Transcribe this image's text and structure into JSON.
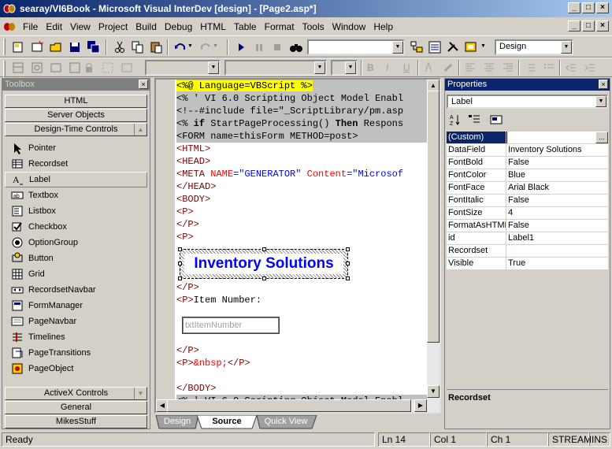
{
  "window": {
    "title": "searay/VI6Book - Microsoft Visual InterDev [design] - [Page2.asp*]",
    "caption_buttons": [
      "_",
      "□",
      "×"
    ]
  },
  "menu": [
    "File",
    "Edit",
    "View",
    "Project",
    "Build",
    "Debug",
    "HTML",
    "Table",
    "Format",
    "Tools",
    "Window",
    "Help"
  ],
  "toolbar": {
    "mode_combo": "Design",
    "paragraph_combo": "",
    "font_combo": ""
  },
  "toolbox": {
    "title": "Toolbox",
    "tabs_top": [
      "HTML",
      "Server Objects",
      "Design-Time Controls"
    ],
    "items": [
      {
        "label": "Pointer",
        "icon": "pointer-icon"
      },
      {
        "label": "Recordset",
        "icon": "recordset-icon"
      },
      {
        "label": "Label",
        "icon": "label-icon"
      },
      {
        "label": "Textbox",
        "icon": "textbox-icon"
      },
      {
        "label": "Listbox",
        "icon": "listbox-icon"
      },
      {
        "label": "Checkbox",
        "icon": "checkbox-icon"
      },
      {
        "label": "OptionGroup",
        "icon": "optiongroup-icon"
      },
      {
        "label": "Button",
        "icon": "button-icon"
      },
      {
        "label": "Grid",
        "icon": "grid-icon"
      },
      {
        "label": "RecordsetNavbar",
        "icon": "recordsetnavbar-icon"
      },
      {
        "label": "FormManager",
        "icon": "formmanager-icon"
      },
      {
        "label": "PageNavbar",
        "icon": "pagenavbar-icon"
      },
      {
        "label": "Timelines",
        "icon": "timelines-icon"
      },
      {
        "label": "PageTransitions",
        "icon": "pagetransitions-icon"
      },
      {
        "label": "PageObject",
        "icon": "pageobject-icon"
      }
    ],
    "tabs_bottom": [
      "ActiveX Controls",
      "General",
      "MikesStuff"
    ]
  },
  "editor": {
    "lines": {
      "l1": "<%@ Language=VBScript %>",
      "l2a": "<% ' VI 6.0 Scripting Object Model Enabl",
      "l3": "<!--#include file=\"_ScriptLibrary/pm.asp",
      "l4a": "<% ",
      "l4b": "if",
      "l4c": " StartPageProcessing() ",
      "l4d": "Then",
      "l4e": " Respons",
      "l5": "<FORM name=thisForm METHOD=post>",
      "l6": "<HTML>",
      "l7": "<HEAD>",
      "l8a": "<META ",
      "l8b": "NAME",
      "l8c": "=",
      "l8d": "\"GENERATOR\"",
      "l8e": " Content",
      "l8f": "=",
      "l8g": "\"Microsof",
      "l9": "</HEAD>",
      "l10": "<BODY>",
      "l11": "<P>",
      "l12": "</P>",
      "l13": "<P>",
      "l14": "</P>",
      "l15a": "<P>",
      "l15b": "Item Number:",
      "l16": "</P>",
      "l17a": "<P>",
      "l17b": "&nbsp;",
      "l17c": "</P>",
      "l18": "</BODY>",
      "l19": "<% ' VI 6.0 Scripting Object Model Enabl"
    },
    "label_control_text": "Inventory Solutions",
    "textbox_placeholder": "txtItemNumber",
    "tabs": [
      "Design",
      "Source",
      "Quick View"
    ]
  },
  "properties": {
    "title": "Properties",
    "object_combo": "Label",
    "rows": [
      {
        "name": "(Custom)",
        "value": ""
      },
      {
        "name": "DataField",
        "value": "Inventory Solutions"
      },
      {
        "name": "FontBold",
        "value": "False"
      },
      {
        "name": "FontColor",
        "value": "Blue"
      },
      {
        "name": "FontFace",
        "value": "Arial Black"
      },
      {
        "name": "FontItalic",
        "value": "False"
      },
      {
        "name": "FontSize",
        "value": "4"
      },
      {
        "name": "FormatAsHTML",
        "value": "False"
      },
      {
        "name": "id",
        "value": "Label1"
      },
      {
        "name": "Recordset",
        "value": ""
      },
      {
        "name": "Visible",
        "value": "True"
      }
    ],
    "description_title": "Recordset"
  },
  "status": {
    "ready": "Ready",
    "line": "Ln 14",
    "col": "Col 1",
    "ch": "Ch 1",
    "mode": "STREAM",
    "ins": "INS"
  },
  "colors": {
    "titlebar": "#0a246a",
    "selection": "#0a246a",
    "tag": "#800000",
    "attribute": "#ff0000",
    "value": "#0000ff",
    "highlight": "#ffff00"
  }
}
